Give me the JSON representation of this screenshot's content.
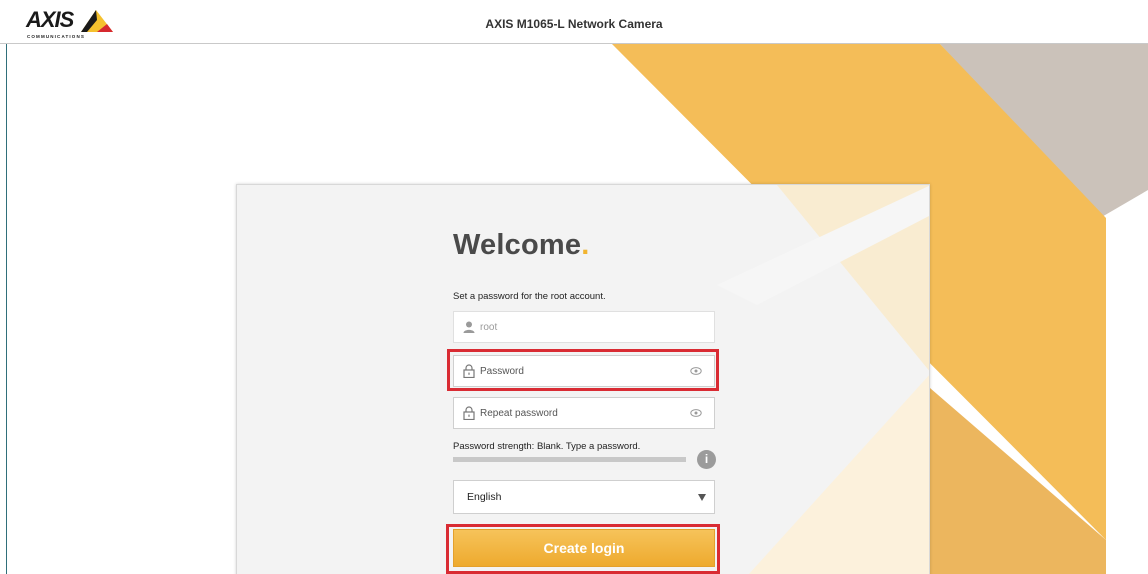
{
  "header": {
    "logo_text": "AXIS",
    "logo_subtext": "COMMUNICATIONS",
    "title": "AXIS M1065-L Network Camera"
  },
  "login": {
    "welcome": "Welcome",
    "welcome_dot": ".",
    "subtitle": "Set a password for the root account.",
    "username_placeholder": "root",
    "password_placeholder": "Password",
    "repeat_placeholder": "Repeat password",
    "strength_label": "Password strength: Blank. Type a password.",
    "strength_level": 0,
    "info_symbol": "i",
    "language": "English",
    "create_button": "Create login"
  },
  "colors": {
    "accent": "#f1b42f",
    "highlight": "#d92b33",
    "bg_gray": "#cbc2ba"
  },
  "icons": {
    "user": "user-icon",
    "lock": "lock-icon",
    "eye": "eye-icon",
    "info": "info-icon",
    "dropdown": "chevron-down-icon"
  }
}
